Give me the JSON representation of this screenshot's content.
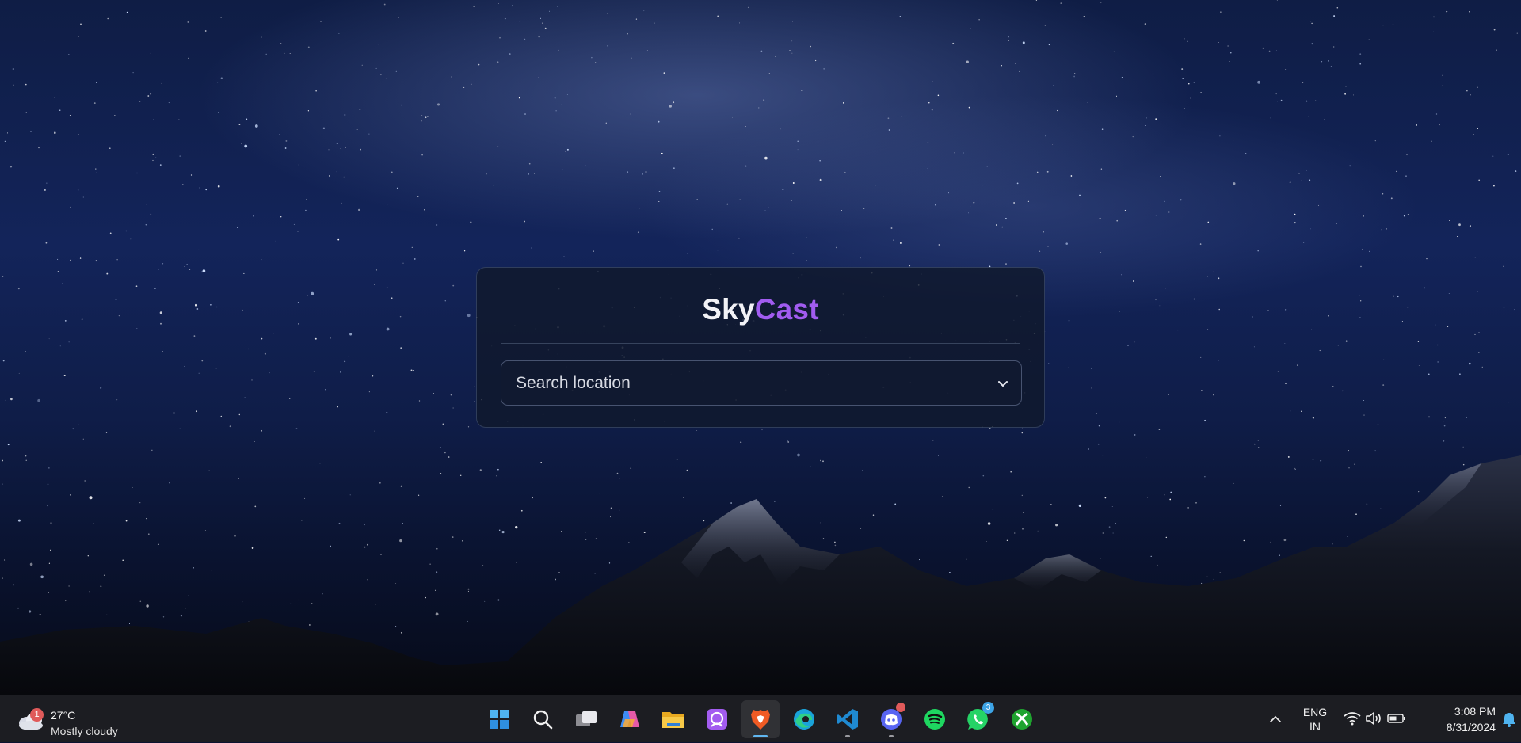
{
  "app": {
    "logo_part1": "Sky",
    "logo_part2": "Cast",
    "search_placeholder": "Search location",
    "colors": {
      "accent": "#a15cf0",
      "card_bg": "#10182c"
    }
  },
  "taskbar": {
    "weather": {
      "badge": "1",
      "temperature": "27°C",
      "condition": "Mostly cloudy"
    },
    "apps": [
      {
        "id": "start",
        "icon": "windows-start-icon"
      },
      {
        "id": "search",
        "icon": "search-icon"
      },
      {
        "id": "task-view",
        "icon": "task-view-icon"
      },
      {
        "id": "copilot",
        "icon": "copilot-icon"
      },
      {
        "id": "file-explorer",
        "icon": "folder-icon"
      },
      {
        "id": "photo-app",
        "icon": "photo-app-icon"
      },
      {
        "id": "brave",
        "icon": "brave-browser-icon",
        "state": "active"
      },
      {
        "id": "edge",
        "icon": "edge-browser-icon"
      },
      {
        "id": "vscode",
        "icon": "vscode-icon",
        "state": "open"
      },
      {
        "id": "discord",
        "icon": "discord-icon",
        "state": "open",
        "badge": "dot"
      },
      {
        "id": "spotify",
        "icon": "spotify-icon"
      },
      {
        "id": "whatsapp",
        "icon": "whatsapp-icon",
        "badge": "3"
      },
      {
        "id": "xbox",
        "icon": "xbox-icon"
      }
    ],
    "whatsapp_badge": "3",
    "language_line1": "ENG",
    "language_line2": "IN",
    "time": "3:08 PM",
    "date": "8/31/2024"
  }
}
